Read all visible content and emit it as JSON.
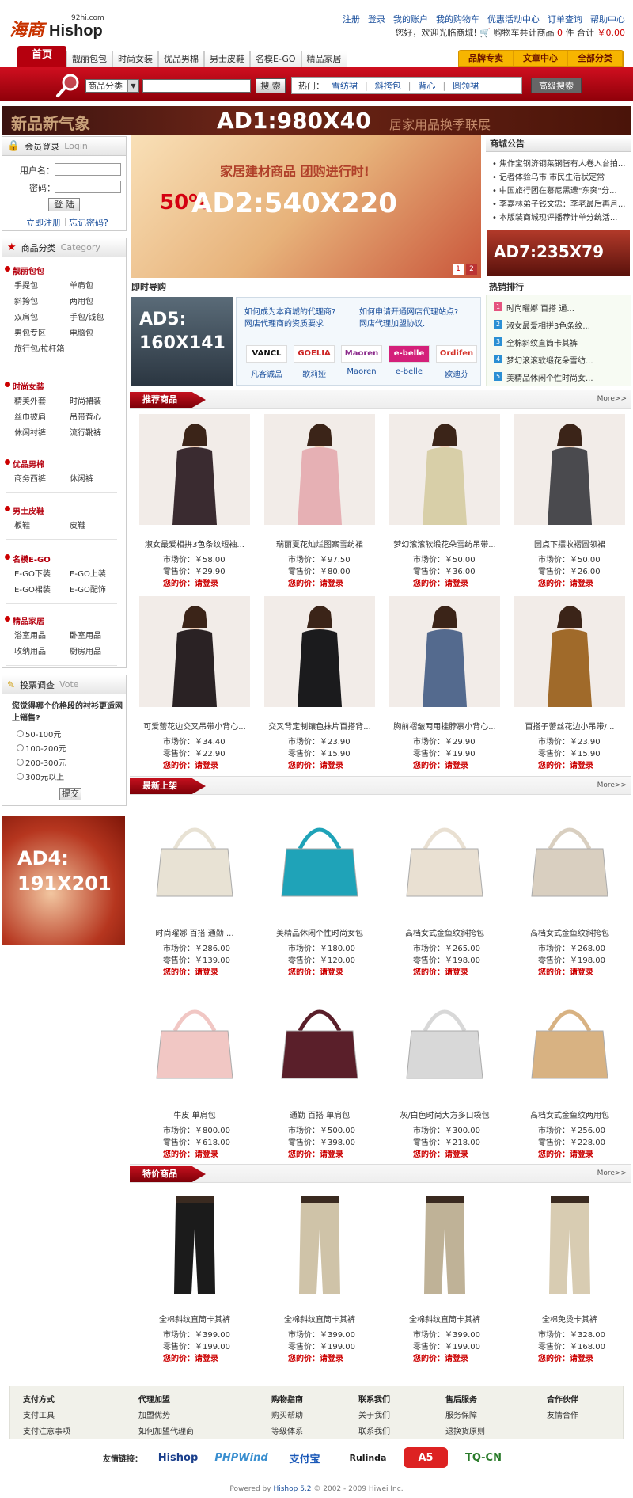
{
  "header": {
    "logo_cn": "海商",
    "logo_en": "Hishop",
    "logo_domain": "92hi.com",
    "topnav": [
      "注册",
      "登录",
      "我的账户",
      "我的购物车",
      "优惠活动中心",
      "订单查询",
      "帮助中心"
    ],
    "welcome": "您好，欢迎光临商城!",
    "cart_label": "购物车共计商品",
    "cart_count": "0",
    "cart_unit": "件",
    "total_label": "合计",
    "total": "￥0.00"
  },
  "nav": {
    "home": "首页",
    "tabs": [
      "靓丽包包",
      "时尚女装",
      "优品男棉",
      "男士皮鞋",
      "名模E-GO",
      "精品家居"
    ],
    "right": [
      "品牌专卖",
      "文章中心",
      "全部分类"
    ]
  },
  "search": {
    "category": "商品分类",
    "button": "搜 索",
    "hot_label": "热门：",
    "hot_words": [
      "雪纺裙",
      "斜挎包",
      "背心",
      "圆领裙"
    ],
    "advanced": "高级搜索"
  },
  "ads": {
    "ad1": "AD1:980X40",
    "ad1_left": "新品新气象",
    "ad1_right": "居家用品换季联展",
    "ad2": "AD2:540X220",
    "ad2_sub": "家居建材商品 团购进行时!",
    "ad2_pct": "50%",
    "ad5": "AD5:\n160X141",
    "ad7": "AD7:235X79",
    "ad4": "AD4:\n191X201"
  },
  "login": {
    "title": "会员登录",
    "title_en": "Login",
    "user_label": "用户名：",
    "pass_label": "密码：",
    "button": "登 陆",
    "register": "立即注册",
    "forgot": "忘记密码?"
  },
  "categories": {
    "title": "商品分类",
    "title_en": "Category",
    "groups": [
      {
        "name": "靓丽包包",
        "items": [
          "手提包",
          "单肩包",
          "斜挎包",
          "两用包",
          "双肩包",
          "手包/钱包",
          "男包专区",
          "电脑包",
          "旅行包/拉杆箱"
        ]
      },
      {
        "name": "时尚女装",
        "items": [
          "精美外套",
          "时尚裙装",
          "丝巾披肩",
          "吊带背心",
          "休闲衬裤",
          "流行靴裤"
        ]
      },
      {
        "name": "优品男棉",
        "items": [
          "商务西裤",
          "休闲裤"
        ]
      },
      {
        "name": "男士皮鞋",
        "items": [
          "板鞋",
          "皮鞋"
        ]
      },
      {
        "name": "名模E-GO",
        "items": [
          "E-GO下装",
          "E-GO上装",
          "E-GO裙装",
          "E-GO配饰"
        ]
      },
      {
        "name": "精品家居",
        "items": [
          "浴室用品",
          "卧室用品",
          "收纳用品",
          "厨房用品"
        ]
      }
    ]
  },
  "vote": {
    "title": "投票调查",
    "title_en": "Vote",
    "question": "您觉得哪个价格段的衬衫更适网上销售?",
    "options": [
      "50-100元",
      "100-200元",
      "200-300元",
      "300元以上"
    ],
    "button": "提交"
  },
  "notice": {
    "title": "商城公告",
    "items": [
      "焦作宝钢济钢莱钢皆有人卷入台拍...",
      "记者体验乌市 市民生活状定常",
      "中国旅行团在慕尼黑遭\"东突\"分...",
      "李嘉林弟子钱文忠：李老最后再月...",
      "本版装商城现评播荐计单分统活..."
    ]
  },
  "guide": {
    "title": "即时导购",
    "links": [
      "如何成为本商城的代理商?",
      "网店代理商的资质要求",
      "如何申请开通网店代理站点?",
      "网店代理加盟协议."
    ],
    "brands": [
      {
        "name": "凡客诚品",
        "logo": "VANCL"
      },
      {
        "name": "歌莉娅",
        "logo": "GOELIA"
      },
      {
        "name": "Maoren",
        "logo": "Maoren"
      },
      {
        "name": "e-belle",
        "logo": "e-belle"
      },
      {
        "name": "欧迪芬",
        "logo": "Ordifen"
      }
    ]
  },
  "hot": {
    "title": "热销排行",
    "items": [
      "时尚曜娜 百搭 通...",
      "淑女最爱相拼3色条纹...",
      "全棉斜纹直筒卡其裤",
      "梦幻滚滚软缎花朵雪纺...",
      "美精品休闲个性时尚女..."
    ]
  },
  "labels": {
    "market": "市场价：",
    "retail": "零售价：",
    "yours": "您的价：",
    "login_price": "请登录",
    "more": "More>>"
  },
  "sections": [
    {
      "title": "推荐商品",
      "products": [
        {
          "name": "淑女最爱相拼3色条纹短袖...",
          "market": "￥58.00",
          "retail": "￥29.90"
        },
        {
          "name": "瑞丽夏花灿烂图案雪纺裙",
          "market": "￥97.50",
          "retail": "￥80.00"
        },
        {
          "name": "梦幻滚滚软缎花朵雪纺吊带...",
          "market": "￥50.00",
          "retail": "￥36.00"
        },
        {
          "name": "圆点下摆收褶圆领裙",
          "market": "￥50.00",
          "retail": "￥26.00"
        },
        {
          "name": "可爱蕾花边交叉吊带小背心...",
          "market": "￥34.40",
          "retail": "￥22.90"
        },
        {
          "name": "交叉背定制镶色抹片百搭背...",
          "market": "￥23.90",
          "retail": "￥15.90"
        },
        {
          "name": "胸前褶皱两用挂脖裹小背心...",
          "market": "￥29.90",
          "retail": "￥19.90"
        },
        {
          "name": "百搭子蕾丝花边小吊带/...",
          "market": "￥23.90",
          "retail": "￥15.90"
        }
      ]
    },
    {
      "title": "最新上架",
      "products": [
        {
          "name": "时尚曜娜 百搭 通勤 ...",
          "market": "￥286.00",
          "retail": "￥139.00"
        },
        {
          "name": "美精品休闲个性时尚女包",
          "market": "￥180.00",
          "retail": "￥120.00"
        },
        {
          "name": "高档女式金鱼纹斜挎包",
          "market": "￥265.00",
          "retail": "￥198.00"
        },
        {
          "name": "高档女式金鱼纹斜挎包",
          "market": "￥268.00",
          "retail": "￥198.00"
        },
        {
          "name": "牛皮 单肩包",
          "market": "￥800.00",
          "retail": "￥618.00"
        },
        {
          "name": "通勤 百搭 单肩包",
          "market": "￥500.00",
          "retail": "￥398.00"
        },
        {
          "name": "灰/白色时尚大方多口袋包",
          "market": "￥300.00",
          "retail": "￥218.00"
        },
        {
          "name": "高档女式金鱼纹两用包",
          "market": "￥256.00",
          "retail": "￥228.00"
        }
      ]
    },
    {
      "title": "特价商品",
      "products": [
        {
          "name": "全棉斜纹直筒卡其裤",
          "market": "￥399.00",
          "retail": "￥199.00"
        },
        {
          "name": "全棉斜纹直筒卡其裤",
          "market": "￥399.00",
          "retail": "￥199.00"
        },
        {
          "name": "全棉斜纹直筒卡其裤",
          "market": "￥399.00",
          "retail": "￥199.00"
        },
        {
          "name": "全棉免烫卡其裤",
          "market": "￥328.00",
          "retail": "￥168.00"
        }
      ]
    }
  ],
  "footer": {
    "cols": [
      {
        "title": "支付方式",
        "items": [
          "支付工具",
          "支付注意事项"
        ]
      },
      {
        "title": "代理加盟",
        "items": [
          "加盟优势",
          "如何加盟代理商"
        ]
      },
      {
        "title": "购物指南",
        "items": [
          "购买帮助",
          "等级体系"
        ]
      },
      {
        "title": "联系我们",
        "items": [
          "关于我们",
          "联系我们"
        ]
      },
      {
        "title": "售后服务",
        "items": [
          "服务保障",
          "退换货原则"
        ]
      },
      {
        "title": "合作伙伴",
        "items": [
          "友情合作"
        ]
      }
    ],
    "links_label": "友情链接：",
    "links": [
      "Hishop",
      "PHPWind",
      "支付宝",
      "Rulinda",
      "A5",
      "TQ-CN"
    ],
    "powered_prefix": "Powered by ",
    "powered_brand": "Hishop",
    "powered_ver": " 5.2",
    "powered_suffix": " © 2002 - 2009 Hiwei Inc."
  },
  "colors": {
    "brand_red": "#b5000e",
    "price_red": "#cc0000",
    "link_blue": "#1a4f9c",
    "nav_gold": "#f7b500"
  }
}
